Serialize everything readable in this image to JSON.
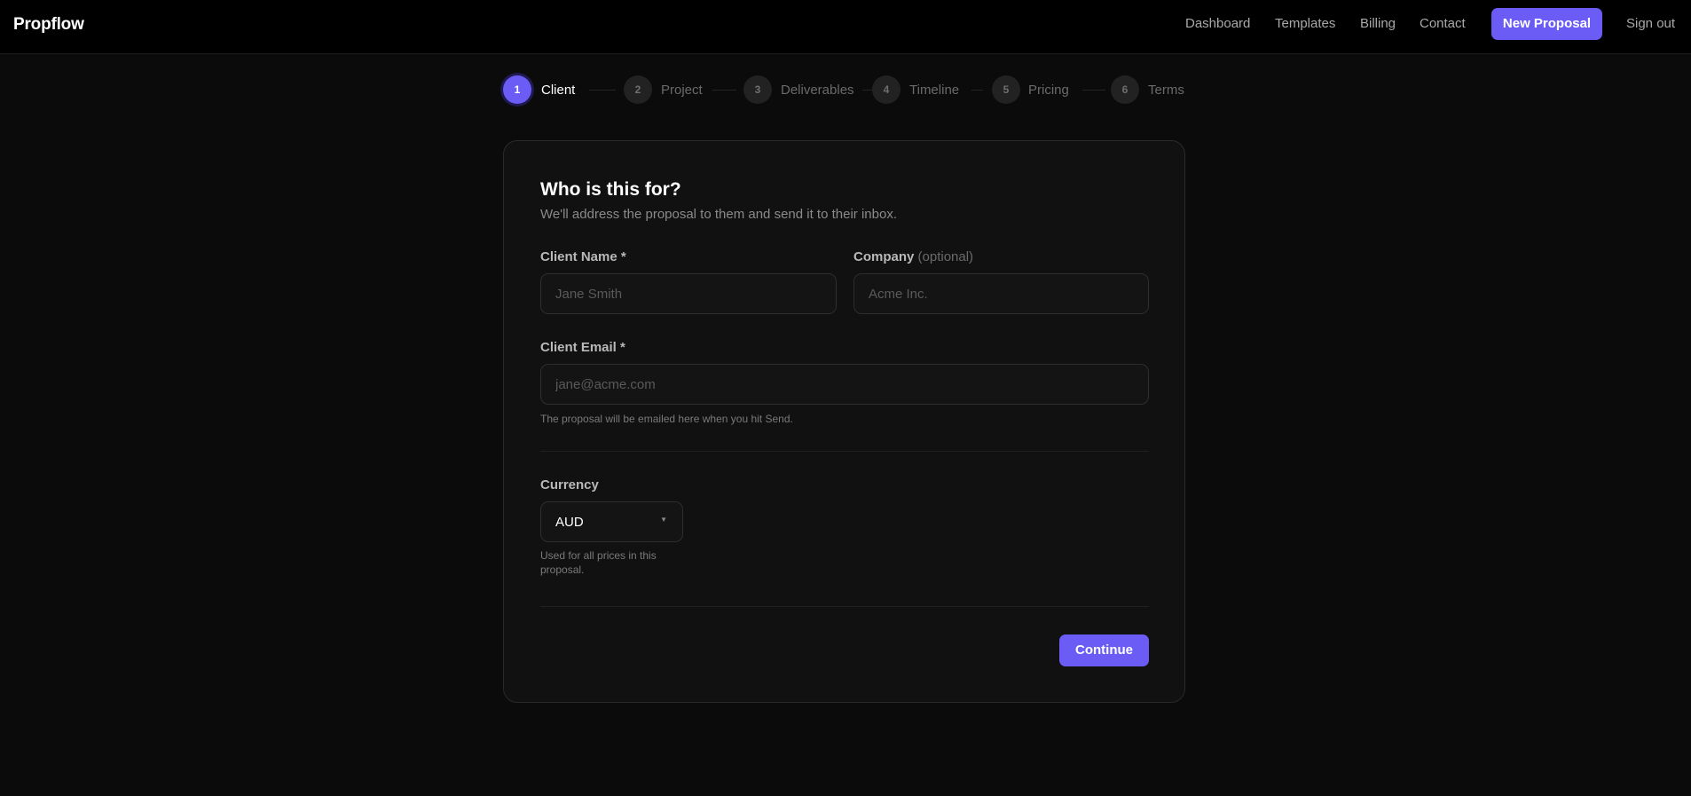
{
  "brand": {
    "name": "Propflow"
  },
  "nav": {
    "links": [
      "Dashboard",
      "Templates",
      "Billing",
      "Contact"
    ],
    "new_proposal": "New Proposal",
    "sign_out": "Sign out"
  },
  "stepper": {
    "current_step": 1,
    "steps": [
      {
        "number": "1",
        "label": "Client"
      },
      {
        "number": "2",
        "label": "Project"
      },
      {
        "number": "3",
        "label": "Deliverables"
      },
      {
        "number": "4",
        "label": "Timeline"
      },
      {
        "number": "5",
        "label": "Pricing"
      },
      {
        "number": "6",
        "label": "Terms"
      }
    ]
  },
  "form": {
    "title": "Who is this for?",
    "subtitle": "We'll address the proposal to them and send it to their inbox.",
    "client_name": {
      "label": "Client Name *",
      "placeholder": "Jane Smith",
      "value": ""
    },
    "company": {
      "label": "Company",
      "optional": "(optional)",
      "placeholder": "Acme Inc.",
      "value": ""
    },
    "client_email": {
      "label": "Client Email *",
      "placeholder": "jane@acme.com",
      "value": "",
      "help": "The proposal will be emailed here when you hit Send."
    },
    "currency": {
      "label": "Currency",
      "selected": "AUD",
      "help_line1": "Used for all prices in this",
      "help_line2": "proposal."
    },
    "continue_label": "Continue"
  },
  "colors": {
    "accent": "#6a5cf5",
    "background": "#0b0b0b",
    "card": "#111111",
    "topbar": "#000000"
  },
  "icons": {
    "select_caret": "chevron-down-icon"
  }
}
